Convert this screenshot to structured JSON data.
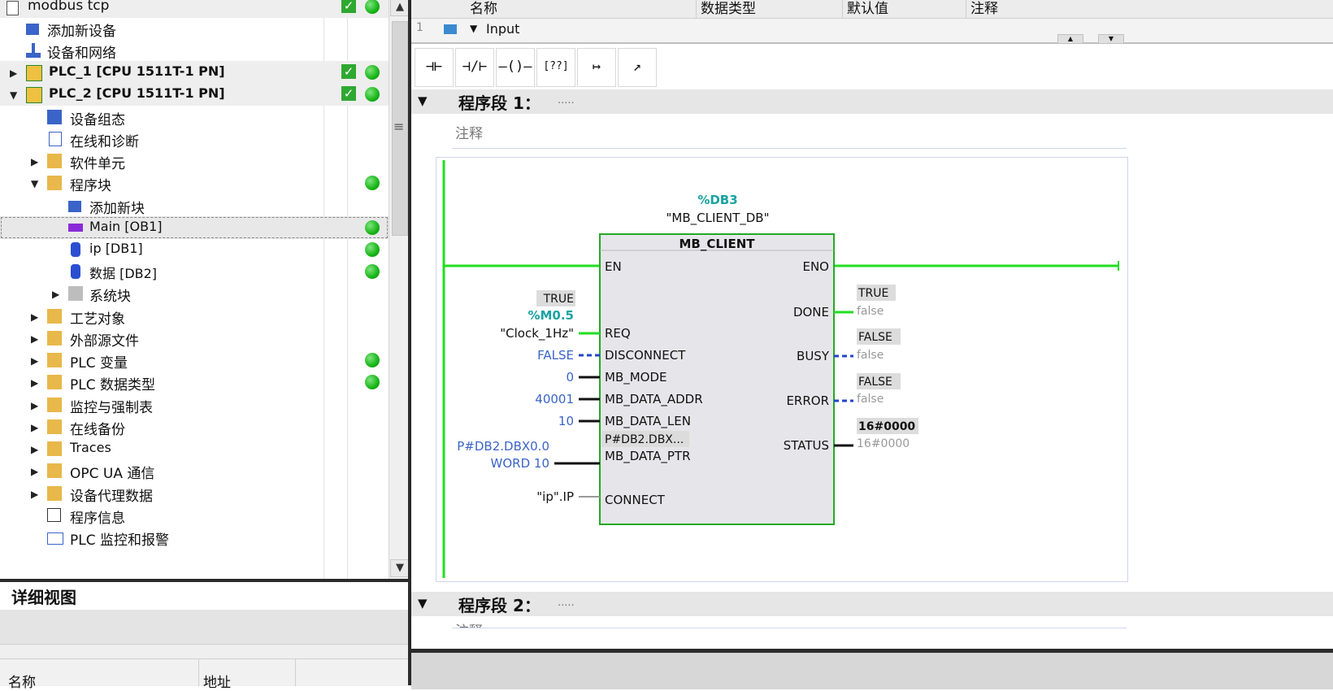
{
  "tree": {
    "rows": [
      {
        "label": "modbus tcp",
        "check": true,
        "dot": true
      },
      {
        "label": "添加新设备"
      },
      {
        "label": "设备和网络"
      },
      {
        "label": "PLC_1 [CPU 1511T-1 PN]",
        "check": true,
        "dot": true
      },
      {
        "label": "PLC_2 [CPU 1511T-1 PN]",
        "check": true,
        "dot": true
      },
      {
        "label": "设备组态"
      },
      {
        "label": "在线和诊断"
      },
      {
        "label": "软件单元"
      },
      {
        "label": "程序块",
        "dot": true
      },
      {
        "label": "添加新块"
      },
      {
        "label": "Main [OB1]",
        "dot": true
      },
      {
        "label": "ip [DB1]",
        "dot": true
      },
      {
        "label": "数据 [DB2]",
        "dot": true
      },
      {
        "label": "系统块"
      },
      {
        "label": "工艺对象"
      },
      {
        "label": "外部源文件"
      },
      {
        "label": "PLC 变量",
        "dot": true
      },
      {
        "label": "PLC 数据类型",
        "dot": true
      },
      {
        "label": "监控与强制表"
      },
      {
        "label": "在线备份"
      },
      {
        "label": "Traces"
      },
      {
        "label": "OPC UA 通信"
      },
      {
        "label": "设备代理数据"
      },
      {
        "label": "程序信息"
      },
      {
        "label": "PLC 监控和报警"
      }
    ]
  },
  "detail": {
    "title": "详细视图",
    "col_name": "名称",
    "col_addr": "地址"
  },
  "interface": {
    "headers": [
      "名称",
      "数据类型",
      "默认值",
      "注释"
    ],
    "row_num": "1",
    "row_name": "Input"
  },
  "toolbar": {
    "buttons": [
      "normally-open-contact",
      "normally-closed-contact",
      "coil",
      "empty-box",
      "open-branch",
      "close-branch"
    ]
  },
  "segments": [
    {
      "title": "程序段 1：",
      "dots": ".....",
      "comment": "注释"
    },
    {
      "title": "程序段 2：",
      "dots": ".....",
      "comment": "注释"
    }
  ],
  "block": {
    "db_addr": "%DB3",
    "db_name": "\"MB_CLIENT_DB\"",
    "title": "MB_CLIENT",
    "inputs": [
      {
        "pin": "EN"
      },
      {
        "pin": "REQ",
        "value": "\"Clock_1Hz\"",
        "addr": "%M0.5",
        "monitor": "TRUE"
      },
      {
        "pin": "DISCONNECT",
        "value": "FALSE"
      },
      {
        "pin": "MB_MODE",
        "value": "0"
      },
      {
        "pin": "MB_DATA_ADDR",
        "value": "40001"
      },
      {
        "pin": "MB_DATA_LEN",
        "value": "10"
      },
      {
        "pin": "MB_DATA_PTR",
        "value": "P#DB2.DBX0.0",
        "value2": "WORD 10",
        "inner": "P#DB2.DBX..."
      },
      {
        "pin": "CONNECT",
        "value": "\"ip\".IP"
      }
    ],
    "outputs": [
      {
        "pin": "ENO"
      },
      {
        "pin": "DONE",
        "monitor": "TRUE",
        "value": "false"
      },
      {
        "pin": "BUSY",
        "monitor": "FALSE",
        "value": "false"
      },
      {
        "pin": "ERROR",
        "monitor": "FALSE",
        "value": "false"
      },
      {
        "pin": "STATUS",
        "monitor": "16#0000",
        "value": "16#0000"
      }
    ]
  },
  "colors": {
    "power": "#22dd22",
    "teal": "#1aa3a3",
    "blue": "#3b64c8",
    "monitor_bg": "#dcdcdc"
  }
}
